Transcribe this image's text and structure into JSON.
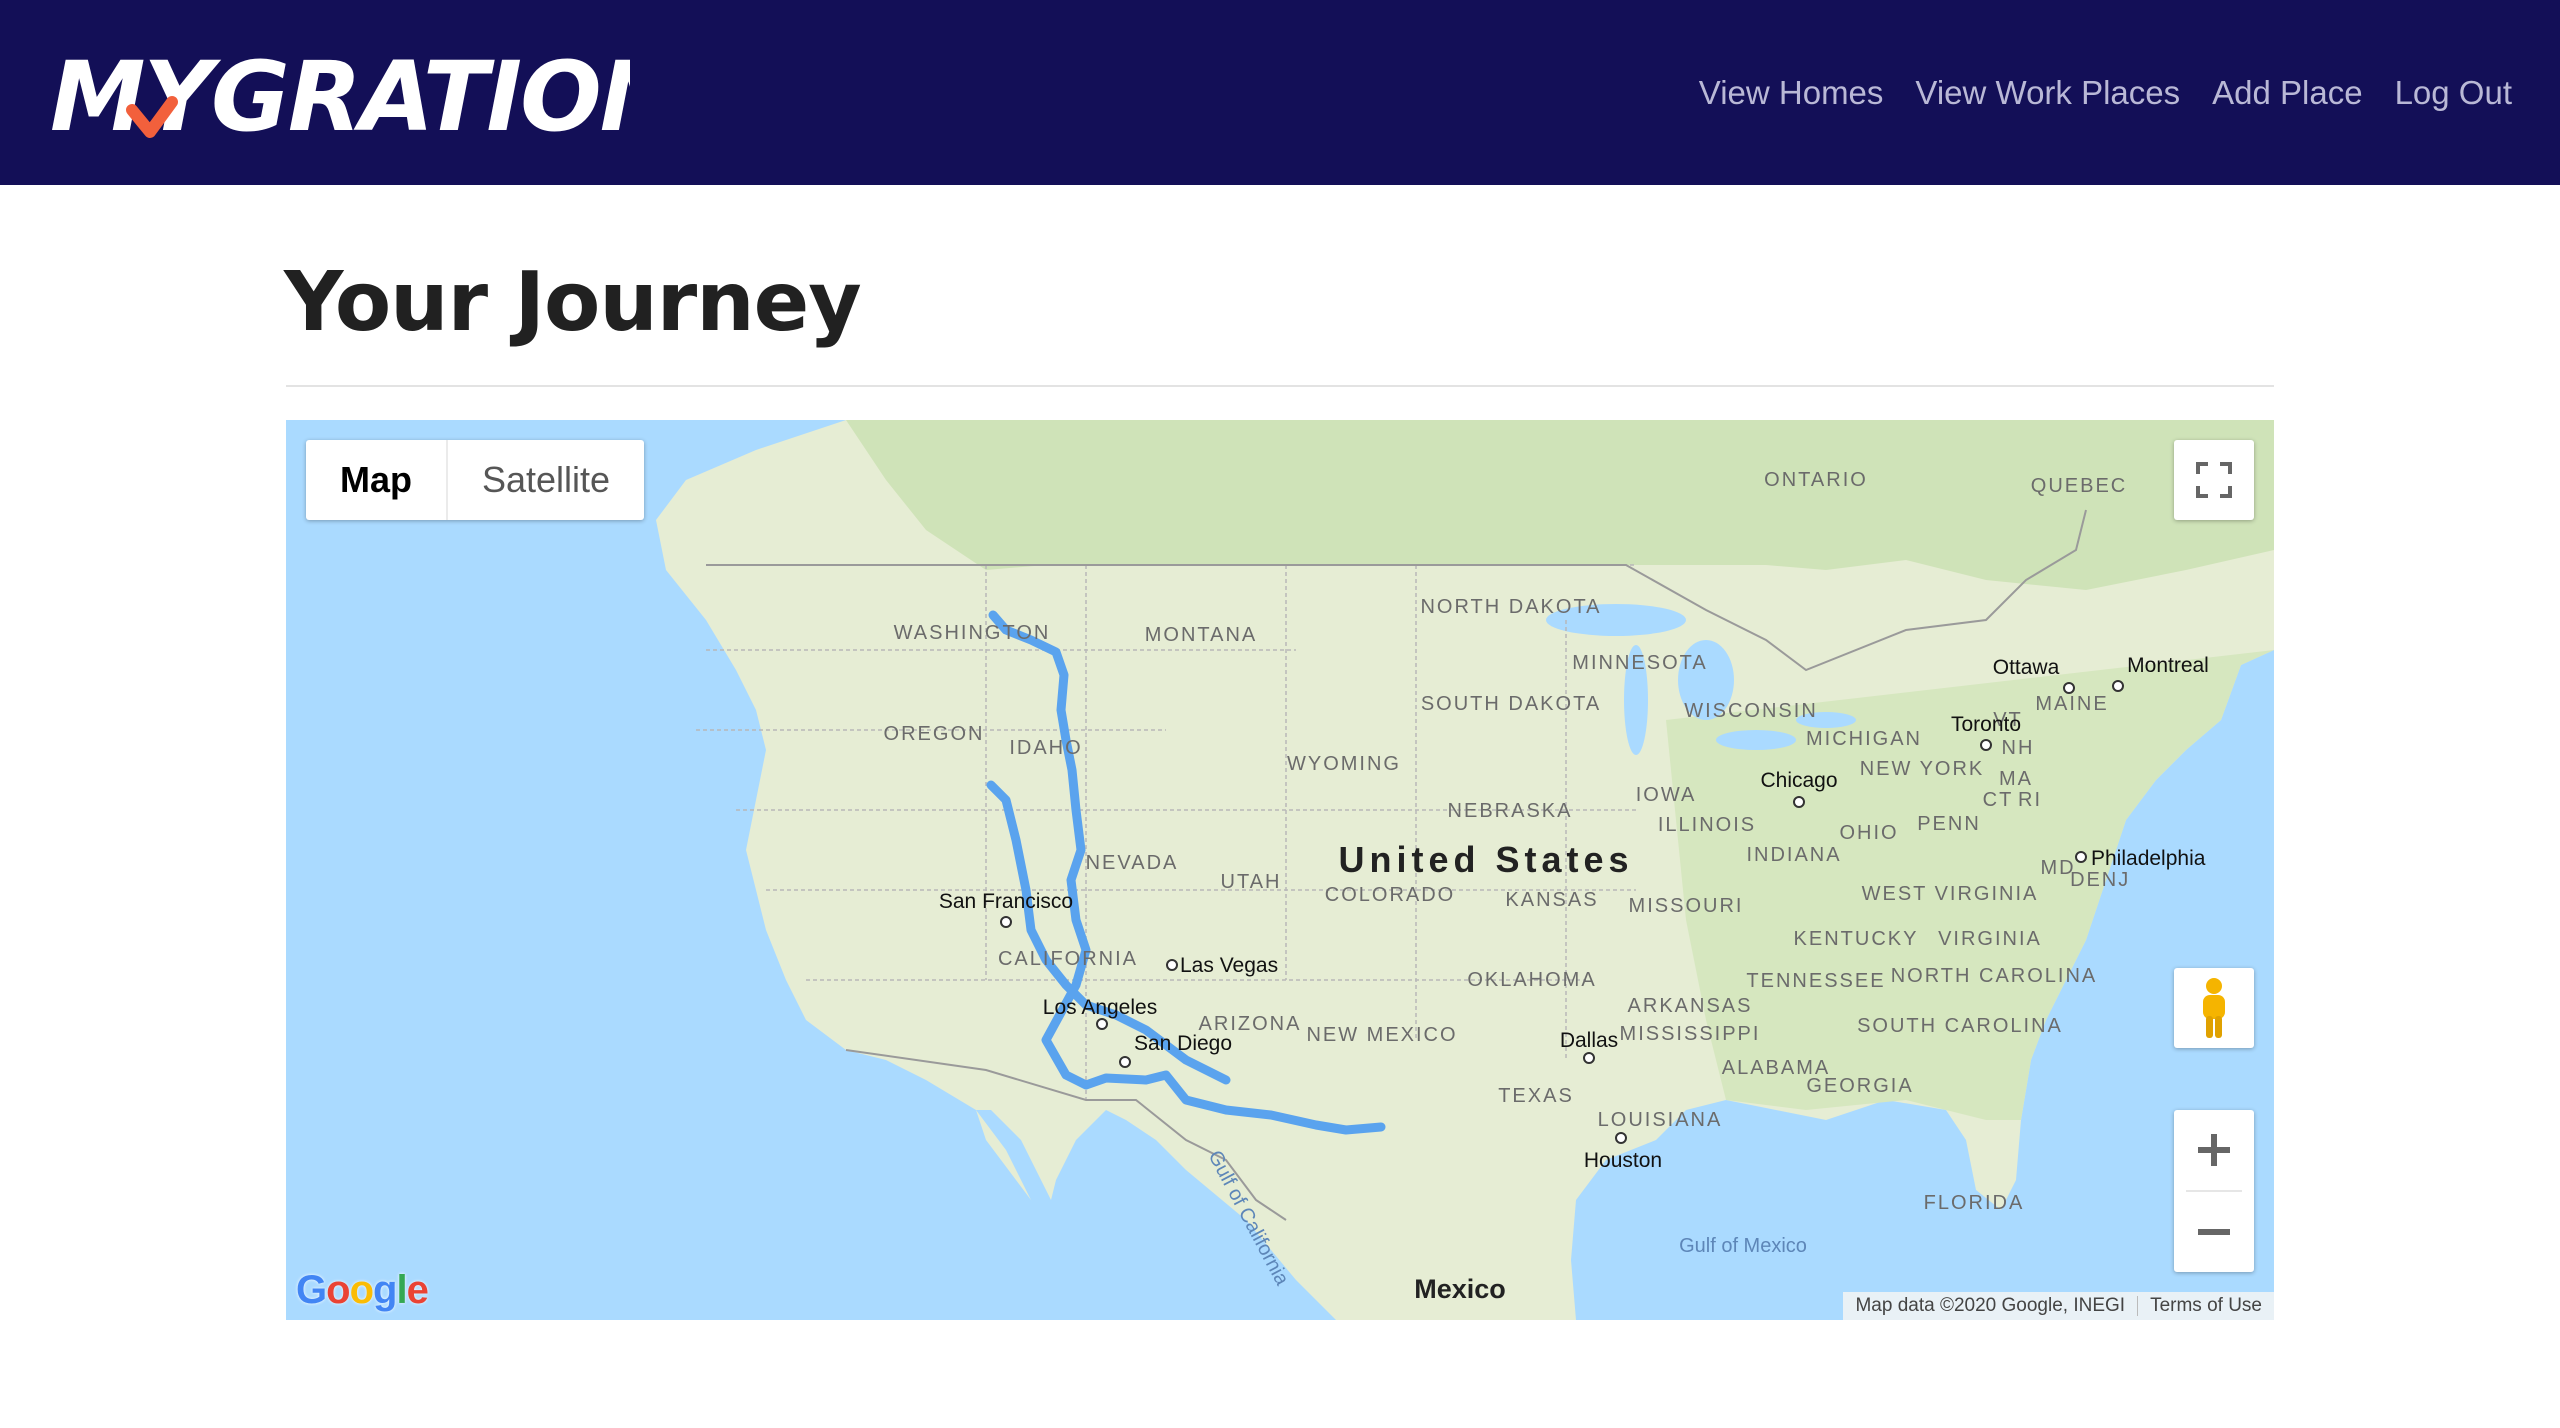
{
  "header": {
    "logo_text": "MYGRATION",
    "nav": [
      "View Homes",
      "View Work Places",
      "Add Place",
      "Log Out"
    ]
  },
  "page": {
    "title": "Your Journey"
  },
  "map": {
    "type_buttons": {
      "map": "Map",
      "satellite": "Satellite",
      "selected": "Map"
    },
    "country_label": "United States",
    "labels": {
      "states": [
        "WASHINGTON",
        "OREGON",
        "IDAHO",
        "MONTANA",
        "NORTH DAKOTA",
        "SOUTH DAKOTA",
        "MINNESOTA",
        "WISCONSIN",
        "MICHIGAN",
        "WYOMING",
        "NEVADA",
        "UTAH",
        "COLORADO",
        "NEBRASKA",
        "IOWA",
        "ILLINOIS",
        "INDIANA",
        "OHIO",
        "PENN",
        "NEW YORK",
        "MAINE",
        "VT",
        "NH",
        "MA",
        "CT",
        "RI",
        "NJ",
        "DE",
        "MD",
        "WEST VIRGINIA",
        "VIRGINIA",
        "KENTUCKY",
        "TENNESSEE",
        "NORTH CAROLINA",
        "SOUTH CAROLINA",
        "GEORGIA",
        "ALABAMA",
        "MISSISSIPPI",
        "ARKANSAS",
        "LOUISIANA",
        "TEXAS",
        "OKLAHOMA",
        "KANSAS",
        "MISSOURI",
        "NEW MEXICO",
        "ARIZONA",
        "CALIFORNIA",
        "FLORIDA",
        "ONTARIO",
        "QUEBEC"
      ],
      "cities": [
        "San Francisco",
        "Las Vegas",
        "Los Angeles",
        "San Diego",
        "Dallas",
        "Houston",
        "Chicago",
        "Toronto",
        "Ottawa",
        "Montreal",
        "Philadelphia"
      ],
      "water": [
        "Gulf of California",
        "Gulf of Mexico"
      ],
      "other": [
        "Mexico"
      ]
    },
    "route_color": "#5aa3ee",
    "controls": {
      "fullscreen": "fullscreen-icon",
      "street_view": "pegman-icon",
      "zoom_in": "plus-icon",
      "zoom_out": "minus-icon"
    },
    "google_logo": "Google",
    "attribution": "Map data ©2020 Google, INEGI",
    "terms": "Terms of Use"
  }
}
